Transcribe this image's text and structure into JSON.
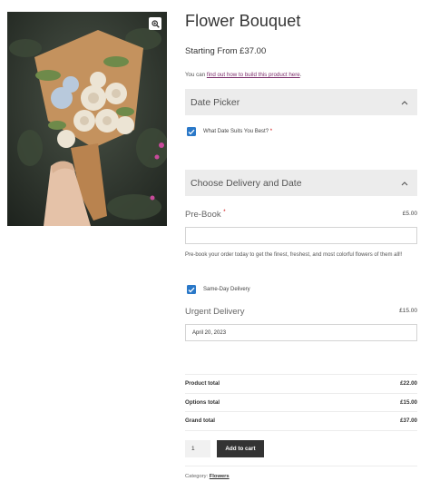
{
  "product": {
    "title": "Flower Bouquet",
    "price": "Starting From £37.00",
    "note_prefix": "You can ",
    "note_link": "find out how to build this product here",
    "note_suffix": ".",
    "image_zoom_icon": "magnifier-plus-icon"
  },
  "date_picker": {
    "title": "Date Picker",
    "checkbox_label": "What Date Suits You Best?",
    "required_mark": "*",
    "checked": true
  },
  "delivery": {
    "title": "Choose Delivery and Date",
    "prebook_label": "Pre-Book",
    "prebook_required": "*",
    "prebook_price": "£5.00",
    "prebook_value": "",
    "prebook_desc": "Pre-book your order today to get the finest, freshest, and most colorful flowers of them all!!",
    "same_day_label": "Same-Day Delivery",
    "same_day_checked": true,
    "urgent_label": "Urgent Delivery",
    "urgent_price": "£15.00",
    "urgent_date": "April 20, 2023"
  },
  "totals": [
    {
      "label": "Product total",
      "value": "£22.00"
    },
    {
      "label": "Options total",
      "value": "£15.00"
    },
    {
      "label": "Grand total",
      "value": "£37.00"
    }
  ],
  "cart": {
    "quantity": "1",
    "button_label": "Add to cart"
  },
  "category": {
    "prefix": "Category: ",
    "link": "Flowers"
  },
  "colors": {
    "accent": "#2a78c8",
    "link": "#7b2c6a",
    "button": "#333333",
    "panel_bg": "#ececec"
  }
}
